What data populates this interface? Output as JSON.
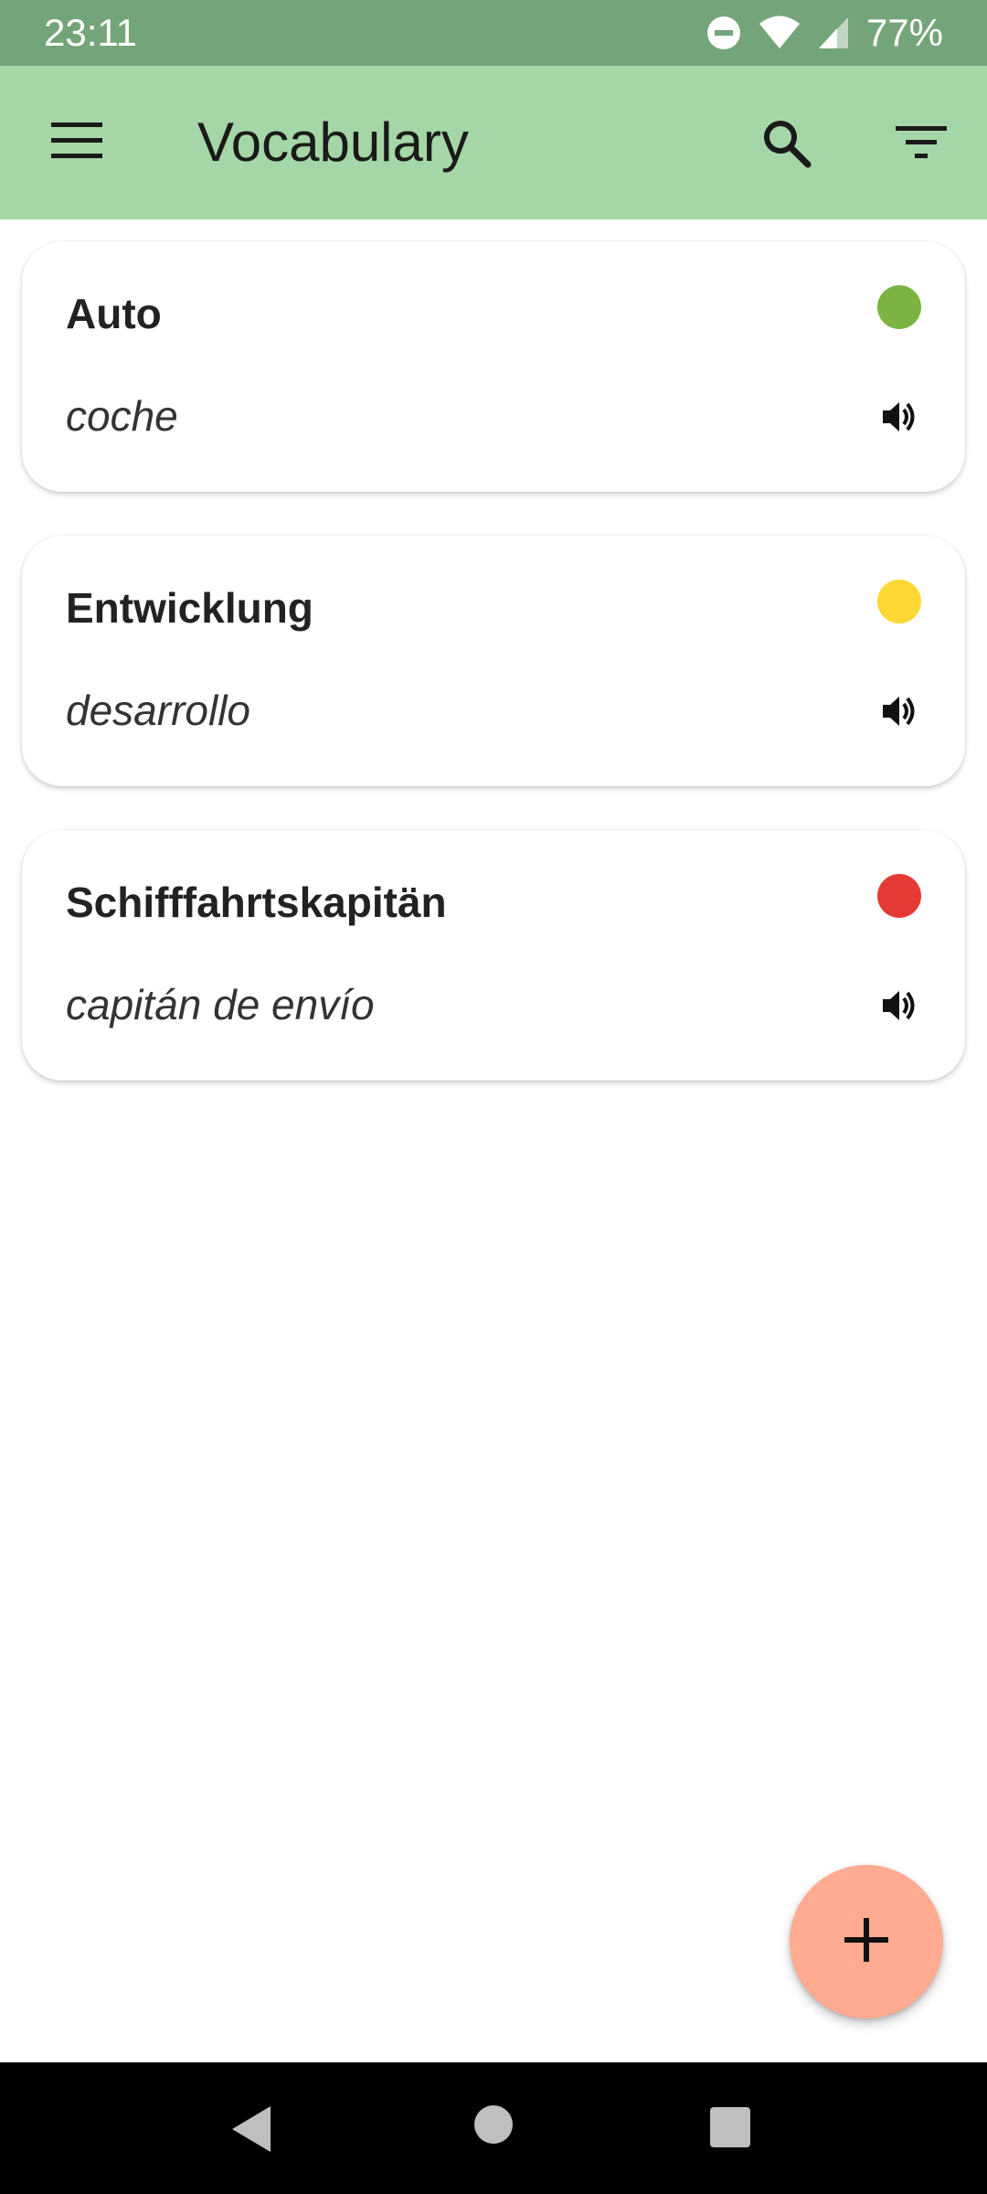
{
  "status_bar": {
    "time": "23:11",
    "battery": "77%",
    "icons": [
      "do-not-disturb-icon",
      "wifi-icon",
      "signal-icon"
    ]
  },
  "app_bar": {
    "title": "Vocabulary",
    "icons": [
      "menu-icon",
      "search-icon",
      "filter-icon"
    ]
  },
  "vocabulary": [
    {
      "term": "Auto",
      "translation": "coche",
      "status_color": "#7cb342"
    },
    {
      "term": "Entwicklung",
      "translation": "desarrollo",
      "status_color": "#fdd835"
    },
    {
      "term": "Schifffahrtskapitän",
      "translation": "capitán de envío",
      "status_color": "#e53935"
    }
  ],
  "fab": {
    "icon": "plus-icon",
    "color": "#ffab91"
  },
  "colors": {
    "status_bar": "#74a57a",
    "app_bar": "#a5d6a7",
    "nav_bar": "#000000"
  }
}
